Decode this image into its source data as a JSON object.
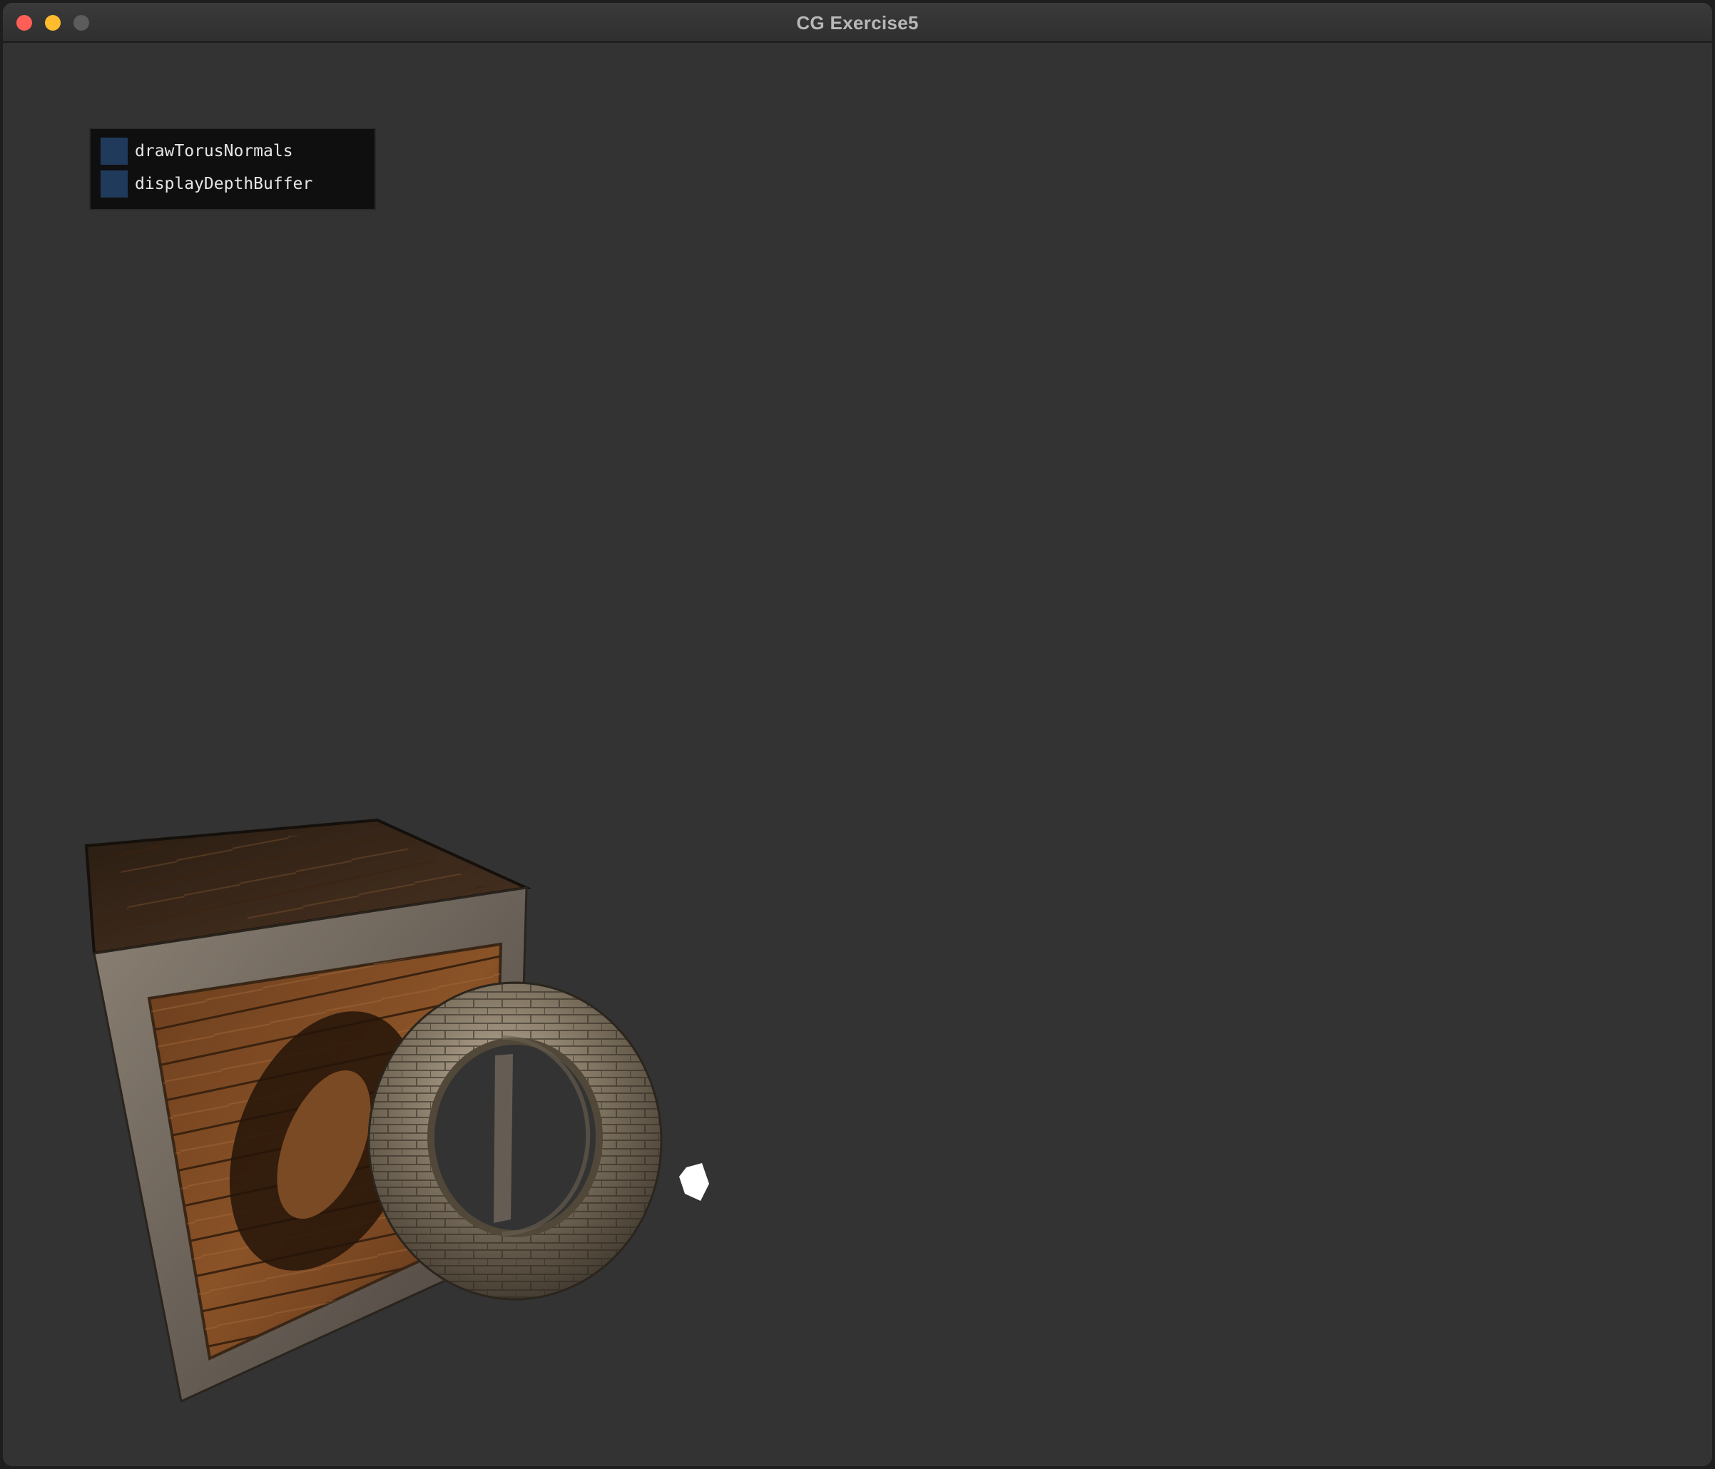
{
  "window": {
    "title": "CG Exercise5"
  },
  "gui": {
    "checkboxes": [
      {
        "label": "drawTorusNormals",
        "checked": false
      },
      {
        "label": "displayDepthBuffer",
        "checked": false
      }
    ]
  },
  "colors": {
    "background": "#333333",
    "checkbox": "#203a5c",
    "panel": "#0f0f0f"
  }
}
